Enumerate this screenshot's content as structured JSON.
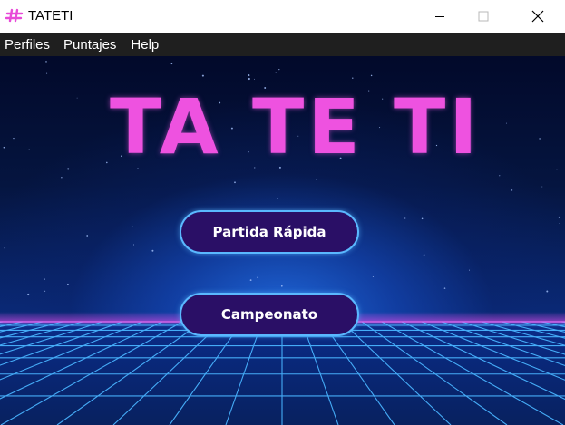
{
  "window": {
    "title": "TATETI",
    "icon": "hash-icon",
    "controls": [
      "minimize",
      "maximize",
      "close"
    ]
  },
  "menu": {
    "items": [
      "Perfiles",
      "Puntajes",
      "Help"
    ]
  },
  "main": {
    "game_title": "TA TE TI",
    "buttons": {
      "quick_match": "Partida Rápida",
      "championship": "Campeonato"
    }
  },
  "colors": {
    "title_pink": "#ee52e0",
    "button_fill": "#2a0f66",
    "button_border": "#5ab8ff",
    "menubar_bg": "#1f1f1f",
    "grid_blue": "#3aa6ff",
    "horizon_magenta": "#d94be6"
  }
}
